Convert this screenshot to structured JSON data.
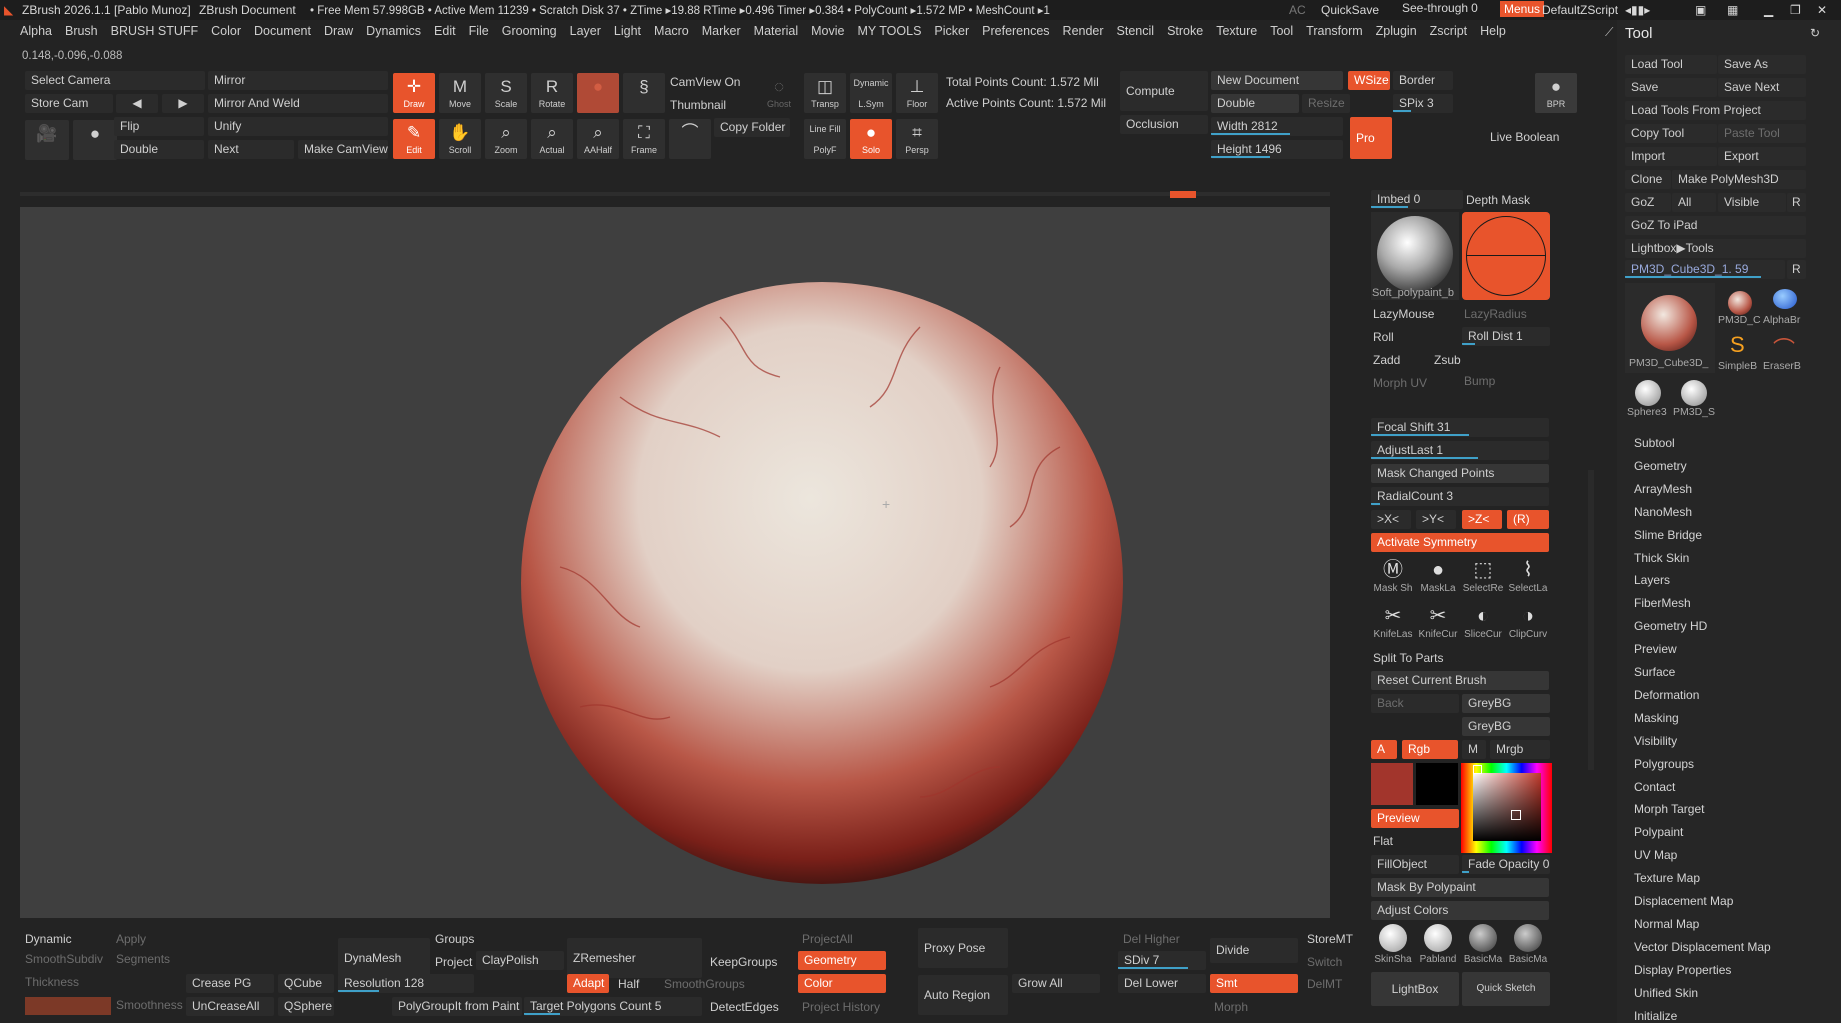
{
  "titlebar": {
    "app": "ZBrush 2026.1.1 [Pablo Munoz]",
    "doc": "ZBrush Document",
    "stats": "• Free Mem 57.998GB • Active Mem 11239 • Scratch Disk 37 • ZTime ▸19.88 RTime ▸0.496 Timer ▸0.384 • PolyCount ▸1.572 MP • MeshCount ▸1",
    "ac": "AC",
    "quicksave": "QuickSave",
    "seethrough": "See-through",
    "seethrough_value": "0",
    "menus": "Menus",
    "script": "DefaultZScript"
  },
  "menus": [
    "Alpha",
    "Brush",
    "BRUSH STUFF",
    "Color",
    "Document",
    "Draw",
    "Dynamics",
    "Edit",
    "File",
    "Grooming",
    "Layer",
    "Light",
    "Macro",
    "Marker",
    "Material",
    "Movie",
    "MY TOOLS",
    "Picker",
    "Preferences",
    "Render",
    "Stencil",
    "Stroke",
    "Texture",
    "Tool",
    "Transform",
    "Zplugin",
    "Zscript",
    "Help"
  ],
  "coords": "0.148,-0.096,-0.088",
  "topshelf": {
    "select_camera": "Select Camera",
    "store_cam": "Store Cam",
    "mirror": "Mirror",
    "mirror_weld": "Mirror And Weld",
    "flip": "Flip",
    "unify": "Unify",
    "double": "Double",
    "next": "Next",
    "make_camview": "Make CamView",
    "draw": "Draw",
    "move": "Move",
    "scale": "Scale",
    "rotate": "Rotate",
    "edit": "Edit",
    "scroll": "Scroll",
    "zoom": "Zoom",
    "actual": "Actual",
    "aahalf": "AAHalf",
    "frame": "Frame",
    "camview_on": "CamView On",
    "thumbnail": "Thumbnail",
    "copy_folder": "Copy Folder",
    "ghost": "Ghost",
    "transp": "Transp",
    "dynamic": "Dynamic",
    "lsym": "L.Sym",
    "floor": "Floor",
    "linefill": "Line Fill",
    "polyf": "PolyF",
    "solo": "Solo",
    "persp": "Persp",
    "total_points": "Total Points Count: 1.572 Mil",
    "active_points": "Active Points Count: 1.572 Mil",
    "compute": "Compute",
    "occlusion": "Occlusion",
    "new_document": "New Document",
    "wsize": "WSize",
    "border": "Border",
    "double2": "Double",
    "resize": "Resize",
    "spix": "SPix 3",
    "width": "Width 2812",
    "height": "Height 1496",
    "pro": "Pro",
    "bpr": "BPR",
    "live_boolean": "Live Boolean"
  },
  "rightshelf": {
    "imbed": "Imbed 0",
    "depth_mask": "Depth Mask",
    "brush_name": "Soft_polypaint_b",
    "lazymouse": "LazyMouse",
    "lazyradius": "LazyRadius",
    "roll": "Roll",
    "roll_dist": "Roll Dist 1",
    "zadd": "Zadd",
    "zsub": "Zsub",
    "morph_uv": "Morph UV",
    "bump": "Bump",
    "focal_shift": "Focal Shift 31",
    "adjust_last": "AdjustLast 1",
    "mask_changed": "Mask Changed Points",
    "radial_count": "RadialCount 3",
    "sym_x": ">X<",
    "sym_y": ">Y<",
    "sym_z": ">Z<",
    "sym_r": "(R)",
    "activate_symmetry": "Activate Symmetry",
    "mask_icons": [
      "Mask Sh",
      "MaskLa",
      "SelectRe",
      "SelectLa"
    ],
    "cut_icons": [
      "KnifeLas",
      "KnifeCur",
      "SliceCur",
      "ClipCurv"
    ],
    "split_to_parts": "Split To Parts",
    "reset_brush": "Reset Current Brush",
    "back": "Back",
    "greybg1": "GreyBG",
    "greybg2": "GreyBG",
    "a": "A",
    "rgb": "Rgb",
    "m": "M",
    "mrgb": "Mrgb",
    "preview": "Preview",
    "flat": "Flat",
    "fillobject": "FillObject",
    "fade_opacity": "Fade Opacity 0",
    "mask_by_polypaint": "Mask By Polypaint",
    "adjust_colors": "Adjust Colors",
    "materials": [
      "SkinSha",
      "Pabland",
      "BasicMa",
      "BasicMa"
    ],
    "lightbox": "LightBox",
    "quick_sketch": "Quick Sketch",
    "main_color": "#a2352c",
    "secondary_color": "#000000"
  },
  "bottomshelf": {
    "dynamic": "Dynamic",
    "apply": "Apply",
    "smoothsubdiv": "SmoothSubdiv",
    "segments": "Segments",
    "thickness": "Thickness",
    "crease_pg": "Crease PG",
    "qcube": "QCube",
    "smoothness": "Smoothness",
    "uncreaseall": "UnCreaseAll",
    "qsphere": "QSphere",
    "dynamesh": "DynaMesh",
    "groups": "Groups",
    "project": "Project",
    "claypolish": "ClayPolish",
    "resolution": "Resolution 128",
    "polygroupit": "PolyGroupIt from Paint",
    "zremesher": "ZRemesher",
    "keepgroups": "KeepGroups",
    "adapt": "Adapt",
    "half": "Half",
    "smoothgroups": "SmoothGroups",
    "target_poly": "Target Polygons Count 5",
    "detectedges": "DetectEdges",
    "projectall": "ProjectAll",
    "geometry": "Geometry",
    "color": "Color",
    "project_history": "Project History",
    "proxy_pose": "Proxy Pose",
    "auto_region": "Auto Region",
    "grow_all": "Grow All",
    "del_higher": "Del Higher",
    "divide": "Divide",
    "storemt": "StoreMT",
    "sdiv": "SDiv 7",
    "switch": "Switch",
    "del_lower": "Del Lower",
    "smt": "Smt",
    "delmt": "DelMT",
    "morph": "Morph"
  },
  "tool_panel": {
    "title": "Tool",
    "load_tool": "Load Tool",
    "save_as": "Save As",
    "save": "Save",
    "save_next": "Save Next",
    "load_from_project": "Load Tools From Project",
    "copy_tool": "Copy Tool",
    "paste_tool": "Paste Tool",
    "import": "Import",
    "export": "Export",
    "clone": "Clone",
    "make_polymesh": "Make PolyMesh3D",
    "goz": "GoZ",
    "all": "All",
    "visible": "Visible",
    "r": "R",
    "goz_ipad": "GoZ To iPad",
    "lightbox_tools": "Lightbox▶Tools",
    "current_tool": "PM3D_Cube3D_1. 59",
    "r2": "R",
    "thumbs": [
      "PM3D_Cube3D_",
      "PM3D_C",
      "AlphaBr",
      "SimpleB",
      "EraserB",
      "Sphere3",
      "PM3D_S"
    ],
    "sections": [
      "Subtool",
      "Geometry",
      "ArrayMesh",
      "NanoMesh",
      "Slime Bridge",
      "Thick Skin",
      "Layers",
      "FiberMesh",
      "Geometry HD",
      "Preview",
      "Surface",
      "Deformation",
      "Masking",
      "Visibility",
      "Polygroups",
      "Contact",
      "Morph Target",
      "Polypaint",
      "UV Map",
      "Texture Map",
      "Displacement Map",
      "Normal Map",
      "Vector Displacement Map",
      "Display Properties",
      "Unified Skin",
      "Initialize"
    ]
  }
}
